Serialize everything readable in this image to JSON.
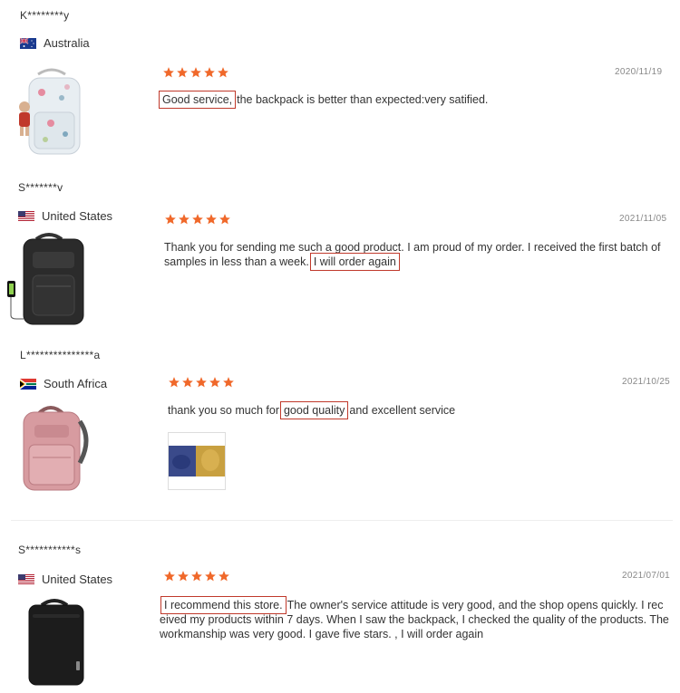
{
  "reviews": [
    {
      "username": "K********y",
      "country": "Australia",
      "flag": "australia-flag",
      "date": "2020/11/19",
      "rating": 5,
      "highlight": "Good service,",
      "text": "the backpack is better than expected:very satified."
    },
    {
      "username": "S*******v",
      "country": "United States",
      "flag": "us-flag",
      "date": "2021/11/05",
      "rating": 5,
      "text_before": "Thank you for sending me such a good product. I am proud of my order. I received the first batch of samples in less than a week.",
      "highlight": "I will order again"
    },
    {
      "username": "L***************a",
      "country": "South Africa",
      "flag": "south-africa-flag",
      "date": "2021/10/25",
      "rating": 5,
      "text_before": "thank you so much for",
      "highlight": "good quality",
      "text_after": "and excellent service"
    },
    {
      "username": "S***********s",
      "country": "United States",
      "flag": "us-flag",
      "date": "2021/07/01",
      "rating": 5,
      "highlight": "I recommend this store.",
      "text": "The owner's service attitude is very good, and the shop opens quickly. I received my products within 7 days. When I saw the backpack, I checked the quality of the products. The workmanship was very good. I gave five stars. , I will order again"
    }
  ],
  "colors": {
    "star": "#f0682a",
    "highlight_border": "#c0392b",
    "date": "#888888"
  }
}
